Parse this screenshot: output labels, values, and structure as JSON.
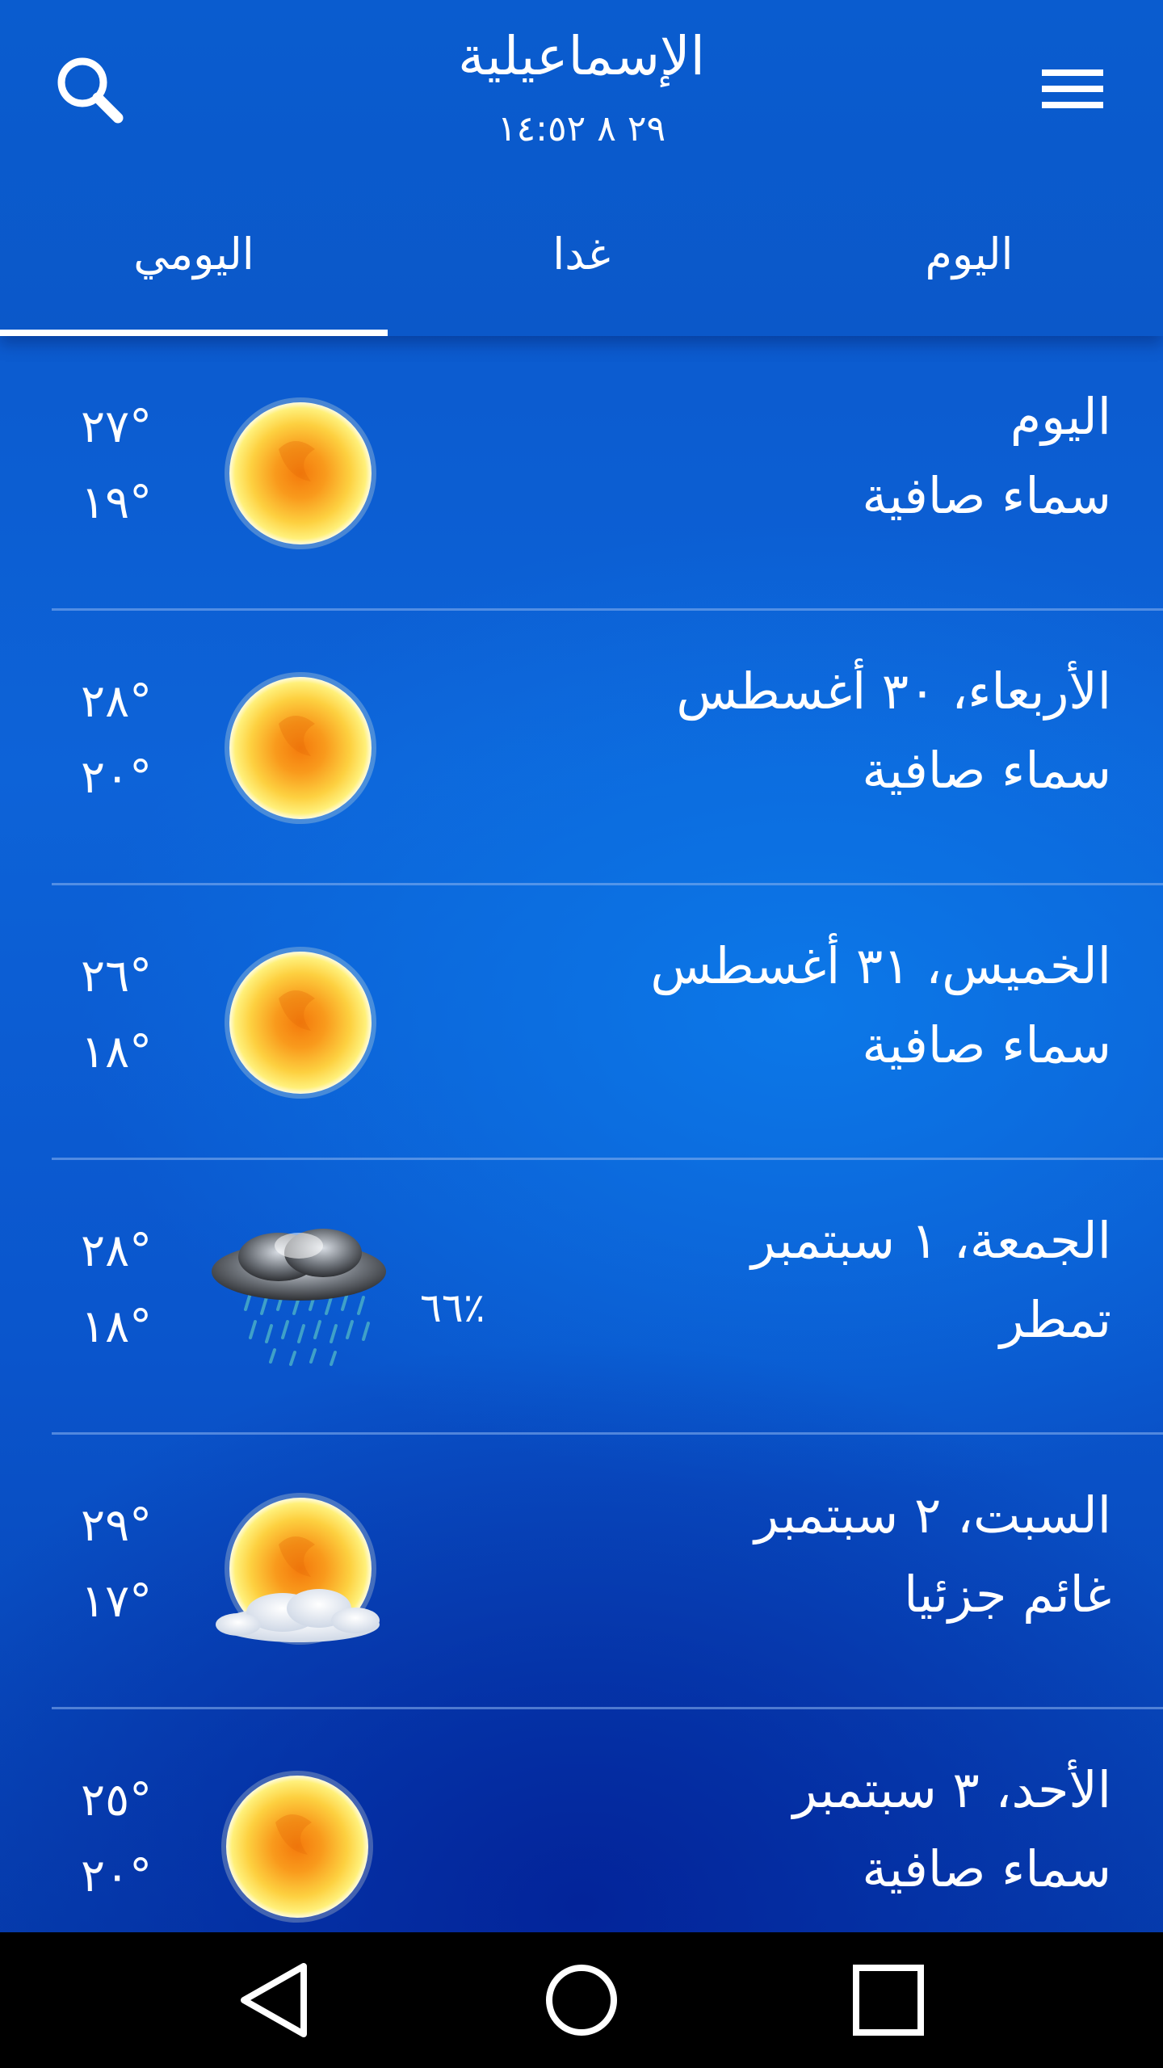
{
  "header": {
    "city": "الإسماعيلية",
    "datetime": "٢٩ ٨ ١٤:٥٢",
    "search_icon": "search-icon",
    "menu_icon": "hamburger-menu-icon"
  },
  "tabs": [
    {
      "label": "اليومي",
      "active": true
    },
    {
      "label": "غدا",
      "active": false
    },
    {
      "label": "اليوم",
      "active": false
    }
  ],
  "forecast": [
    {
      "day": "اليوم",
      "condition": "سماء صافية",
      "high": "٢٧°",
      "low": "١٩°",
      "icon": "sun-icon",
      "precip": ""
    },
    {
      "day": "الأربعاء، ٣٠ أغسطس",
      "condition": "سماء صافية",
      "high": "٢٨°",
      "low": "٢٠°",
      "icon": "sun-icon",
      "precip": ""
    },
    {
      "day": "الخميس، ٣١ أغسطس",
      "condition": "سماء صافية",
      "high": "٢٦°",
      "low": "١٨°",
      "icon": "sun-icon",
      "precip": ""
    },
    {
      "day": "الجمعة، ١ سبتمبر",
      "condition": "تمطر",
      "high": "٢٨°",
      "low": "١٨°",
      "icon": "rain-cloud-icon",
      "precip": "٦٦٪"
    },
    {
      "day": "السبت، ٢ سبتمبر",
      "condition": "غائم جزئيا",
      "high": "٢٩°",
      "low": "١٧°",
      "icon": "partly-cloudy-icon",
      "precip": ""
    },
    {
      "day": "الأحد، ٣ سبتمبر",
      "condition": "سماء صافية",
      "high": "٢٥°",
      "low": "٢٠°",
      "icon": "sun-icon",
      "precip": ""
    }
  ],
  "navbar": {
    "back_icon": "back-triangle-icon",
    "home_icon": "home-circle-icon",
    "recents_icon": "recents-square-icon"
  },
  "colors": {
    "accent": "#0b58c9",
    "text": "#ffffff",
    "navbar": "#000000"
  }
}
